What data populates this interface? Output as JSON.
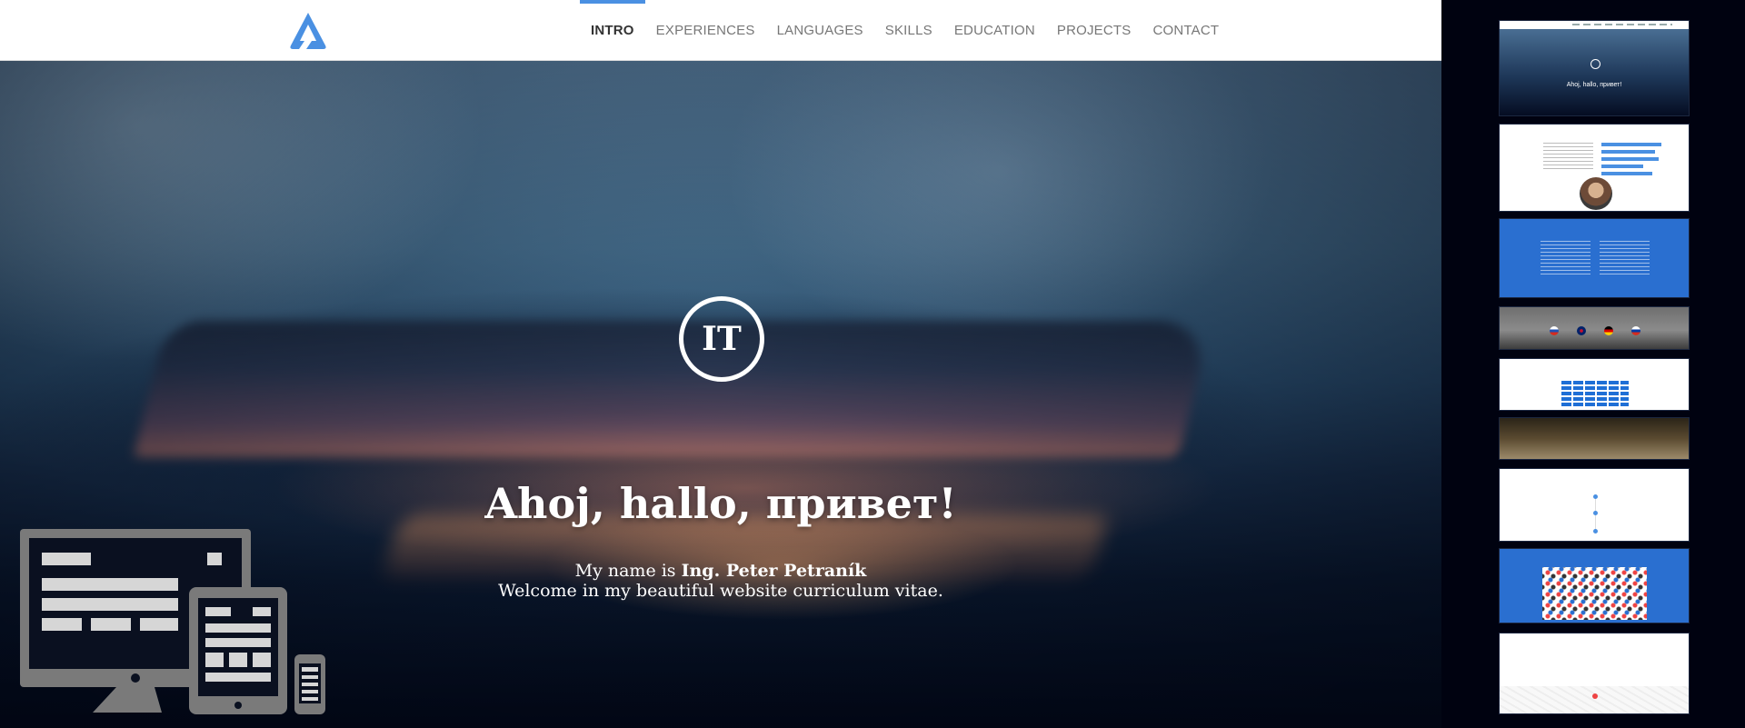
{
  "nav": {
    "items": [
      {
        "label": "INTRO",
        "active": true
      },
      {
        "label": "EXPERIENCES",
        "active": false
      },
      {
        "label": "LANGUAGES",
        "active": false
      },
      {
        "label": "SKILLS",
        "active": false
      },
      {
        "label": "EDUCATION",
        "active": false
      },
      {
        "label": "PROJECTS",
        "active": false
      },
      {
        "label": "CONTACT",
        "active": false
      }
    ],
    "accent_color": "#4a90e2"
  },
  "logo": {
    "icon": "triangle-logo-icon",
    "color": "#4a90e2"
  },
  "hero": {
    "badge": "IT",
    "greeting": "Ahoj, hallo, привет!",
    "intro_prefix": "My name is ",
    "name": "Ing. Peter Petraník",
    "welcome": "Welcome in my beautiful website curriculum vitae.",
    "illustration": "responsive-devices-icon"
  },
  "sidebar": {
    "thumbnails": [
      {
        "section": "intro"
      },
      {
        "section": "about"
      },
      {
        "section": "experiences"
      },
      {
        "section": "languages"
      },
      {
        "section": "skills"
      },
      {
        "section": "education"
      },
      {
        "section": "projects"
      },
      {
        "section": "tools"
      },
      {
        "section": "contact"
      }
    ]
  }
}
